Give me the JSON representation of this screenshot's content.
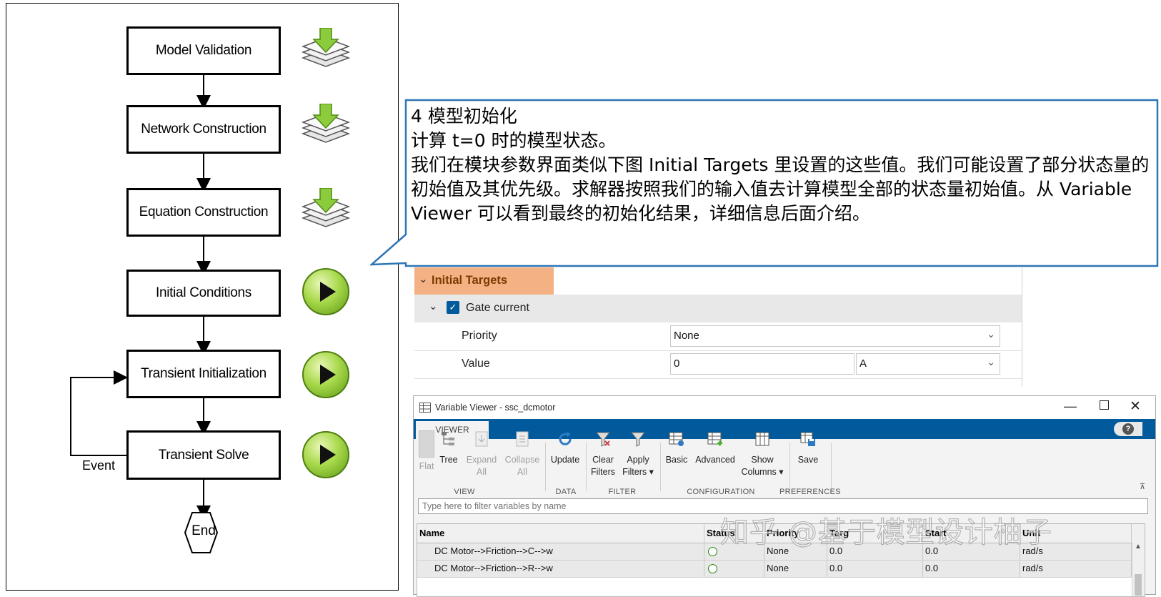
{
  "flowchart": {
    "steps": [
      {
        "label": "Model Validation",
        "icon": "layers-download-icon"
      },
      {
        "label": "Network Construction",
        "icon": "layers-download-icon"
      },
      {
        "label": "Equation Construction",
        "icon": "layers-download-icon"
      },
      {
        "label": "Initial Conditions",
        "icon": "play-icon"
      },
      {
        "label": "Transient Initialization",
        "icon": "play-icon"
      },
      {
        "label": "Transient Solve",
        "icon": "play-icon"
      }
    ],
    "end_label": "End",
    "event_label": "Event"
  },
  "callout": {
    "line1": "4 模型初始化",
    "line2": "计算 t=0 时的模型状态。",
    "line3": "我们在模块参数界面类似下图 Initial Targets 里设置的这些值。我们可能设置了部分状态量的初始值及其优先级。求解器按照我们的输入值去计算模型全部的状态量初始值。从 Variable Viewer 可以看到最终的初始化结果，详细信息后面介绍。"
  },
  "property_panel": {
    "section_title": "Initial Targets",
    "item_label": "Gate current",
    "item_checked": true,
    "priority_label": "Priority",
    "priority_value": "None",
    "value_label": "Value",
    "value_value": "0",
    "value_unit": "A"
  },
  "variable_viewer": {
    "title": "Variable Viewer - ssc_dcmotor",
    "tab": "VIEWER",
    "help_label": "?",
    "toolbar": {
      "flat": "Flat",
      "tree": "Tree",
      "expand_all_1": "Expand",
      "expand_all_2": "All",
      "collapse_all_1": "Collapse",
      "collapse_all_2": "All",
      "update": "Update",
      "clear_filters_1": "Clear",
      "clear_filters_2": "Filters",
      "apply_filters_1": "Apply",
      "apply_filters_2": "Filters",
      "basic": "Basic",
      "advanced": "Advanced",
      "show_columns_1": "Show",
      "show_columns_2": "Columns",
      "save": "Save"
    },
    "groups": {
      "view": "VIEW",
      "data": "DATA",
      "filter": "FILTER",
      "configuration": "CONFIGURATION",
      "preferences": "PREFERENCES"
    },
    "filter_placeholder": "Type here to filter variables by name",
    "columns": {
      "name": "Name",
      "status": "Status",
      "priority": "Priority",
      "target": "Targ",
      "start": "Start",
      "unit": "Unit"
    },
    "rows": [
      {
        "name": "DC Motor-->Friction-->C-->w",
        "priority": "None",
        "target": "0.0",
        "start": "0.0",
        "unit": "rad/s"
      },
      {
        "name": "DC Motor-->Friction-->R-->w",
        "priority": "None",
        "target": "0.0",
        "start": "0.0",
        "unit": "rad/s"
      }
    ],
    "status_color": "#3fb618"
  },
  "watermark": "知乎 @基于模型设计柚子",
  "colors": {
    "accent_blue": "#005a9c",
    "callout_border": "#2e75b6",
    "section_highlight": "#f4b183"
  }
}
